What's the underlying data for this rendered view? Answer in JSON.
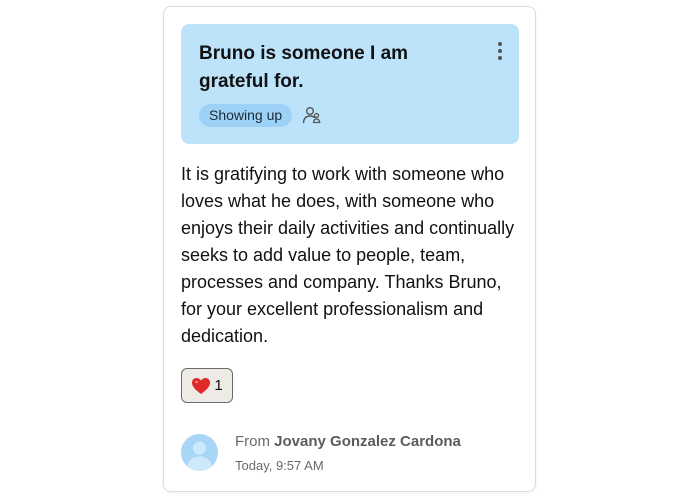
{
  "card": {
    "title": "Bruno is someone I am grateful for.",
    "tag": "Showing up",
    "message": "It is gratifying to work with someone who loves what he does, with someone who enjoys their daily activities and continually seeks to add value to people, team, processes and company. Thanks Bruno, for your excellent professionalism and dedication.",
    "reaction": {
      "icon": "heart-icon",
      "count": "1"
    },
    "author": {
      "from_prefix": "From",
      "name": "Jovany Gonzalez Cardona",
      "timestamp": "Today, 9:57 AM"
    }
  },
  "icons": {
    "menu": "more-vertical-icon",
    "audience": "people-icon",
    "avatar": "user-avatar-placeholder"
  },
  "colors": {
    "banner": "#bde3fb",
    "tag": "#9dd2f6",
    "reaction_bg": "#eeebe7",
    "heart": "#e02a2a",
    "avatar": "#a7d6f6"
  }
}
